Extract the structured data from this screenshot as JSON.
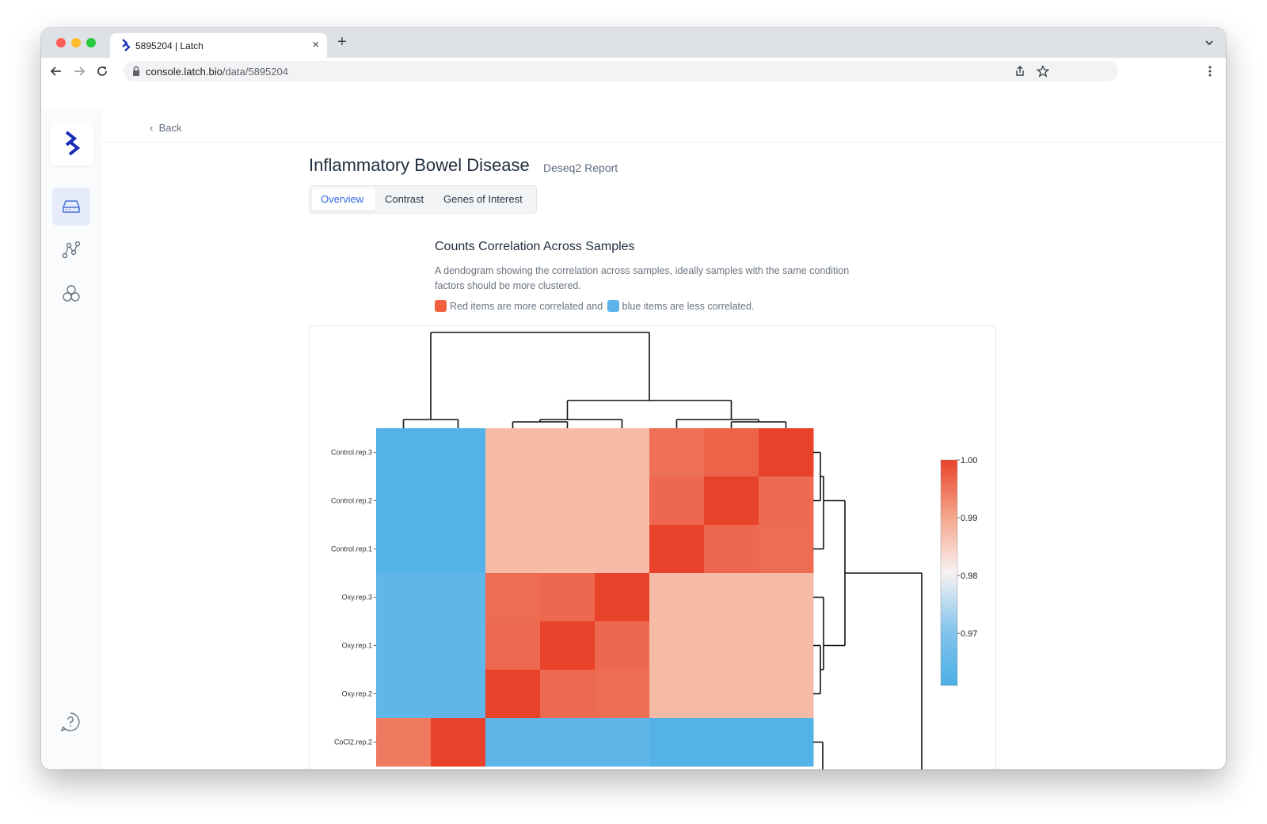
{
  "browser": {
    "tab_title": "5895204 | Latch",
    "url_host": "console.latch.bio",
    "url_path": "/data/5895204"
  },
  "sidebar": {
    "items": [
      {
        "name": "data",
        "icon": "drive-icon",
        "active": true
      },
      {
        "name": "workflows",
        "icon": "graph-nodes-icon",
        "active": false
      },
      {
        "name": "modules",
        "icon": "hexagons-icon",
        "active": false
      }
    ],
    "help_icon": "help-icon"
  },
  "page": {
    "back_label": "Back",
    "title": "Inflammatory Bowel Disease",
    "subtitle": "Deseq2 Report",
    "tabs": [
      {
        "label": "Overview",
        "active": true
      },
      {
        "label": "Contrast",
        "active": false
      },
      {
        "label": "Genes of Interest",
        "active": false
      }
    ]
  },
  "section": {
    "title": "Counts Correlation Across Samples",
    "description": "A dendogram showing the correlation across samples, ideally samples with the same condition factors should be more clustered.",
    "legend_red_text": "Red items are more correlated and",
    "legend_blue_text": "blue items are less correlated.",
    "red_color": "#f0613f",
    "blue_color": "#5ab4ea"
  },
  "chart_data": {
    "type": "heatmap",
    "title": "",
    "row_labels": [
      "Control.rep.3",
      "Control.rep.2",
      "Control.rep.1",
      "Oxy.rep.3",
      "Oxy.rep.1",
      "Oxy.rep.2",
      "CoCl2.rep.2"
    ],
    "colorbar": {
      "ticks": [
        "1.00",
        "0.99",
        "0.98",
        "0.97"
      ],
      "range": [
        0.961,
        1.0
      ],
      "colors": [
        "#e8432a",
        "#f4a58a",
        "#f8f2f2",
        "#86c5ec",
        "#4aaee6"
      ]
    },
    "values": [
      [
        0.9625,
        0.9625,
        0.9875,
        0.9875,
        0.9875,
        0.9955,
        0.9968,
        1.0
      ],
      [
        0.9625,
        0.9625,
        0.9875,
        0.9875,
        0.9875,
        0.9963,
        1.0,
        0.996
      ],
      [
        0.9625,
        0.9625,
        0.9875,
        0.9875,
        0.9875,
        1.0,
        0.9963,
        0.9958
      ],
      [
        0.9645,
        0.9645,
        0.9958,
        0.9963,
        1.0,
        0.9875,
        0.9875,
        0.9875
      ],
      [
        0.9645,
        0.9645,
        0.9962,
        1.0,
        0.9963,
        0.9875,
        0.9875,
        0.9875
      ],
      [
        0.9645,
        0.9645,
        1.0,
        0.9962,
        0.9958,
        0.9875,
        0.9875,
        0.9875
      ],
      [
        0.9945,
        1.0,
        0.9645,
        0.9645,
        0.9645,
        0.9625,
        0.9625,
        0.9625
      ]
    ]
  }
}
